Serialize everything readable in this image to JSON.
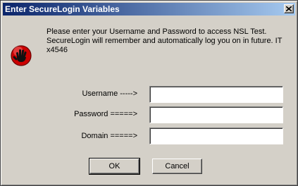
{
  "window": {
    "title": "Enter SecureLogin Variables",
    "close_icon": "close-icon"
  },
  "icon": {
    "name": "hand-stop-icon",
    "color": "#cc0000"
  },
  "message": {
    "line1": "Please enter your Username and Password to access NSL Test.",
    "line2": "SecureLogin will remember and automatically log you on in future.  IT",
    "line3": "x4546"
  },
  "fields": {
    "username": {
      "label": "Username ----->",
      "value": ""
    },
    "password": {
      "label": "Password =====>",
      "value": ""
    },
    "domain": {
      "label": "Domain =====>",
      "value": ""
    }
  },
  "buttons": {
    "ok": "OK",
    "cancel": "Cancel"
  },
  "colors": {
    "title_start": "#0a246a",
    "title_end": "#a6caf0",
    "face": "#d4d0c8"
  }
}
